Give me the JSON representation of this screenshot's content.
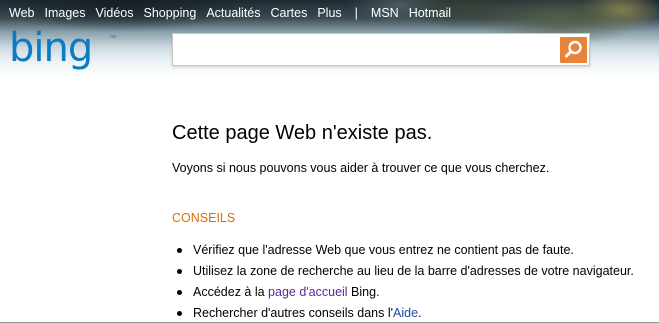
{
  "nav": {
    "items": [
      "Web",
      "Images",
      "Vidéos",
      "Shopping",
      "Actualités",
      "Cartes",
      "Plus"
    ],
    "separator": "|",
    "extra": [
      "MSN",
      "Hotmail"
    ]
  },
  "logo": {
    "text": "bing",
    "color": "#0c7bc2"
  },
  "search": {
    "value": "",
    "placeholder": ""
  },
  "colors": {
    "accent": "#e8833a",
    "tips_heading": "#dd6e00",
    "link_visited": "#5a2a8c",
    "link": "#1a4da1"
  },
  "main": {
    "title": "Cette page Web n'existe pas.",
    "subtitle": "Voyons si nous pouvons vous aider à trouver ce que vous cherchez.",
    "tips_heading": "CONSEILS",
    "tips": {
      "t1": "Vérifiez que l'adresse Web que vous entrez ne contient pas de faute.",
      "t2": "Utilisez la zone de recherche au lieu de la barre d'adresses de votre navigateur.",
      "t3_before": "Accédez à la ",
      "t3_link": "page d'accueil",
      "t3_after": " Bing.",
      "t4_before": "Rechercher d'autres conseils dans l'",
      "t4_link": "Aide",
      "t4_after": "."
    }
  }
}
